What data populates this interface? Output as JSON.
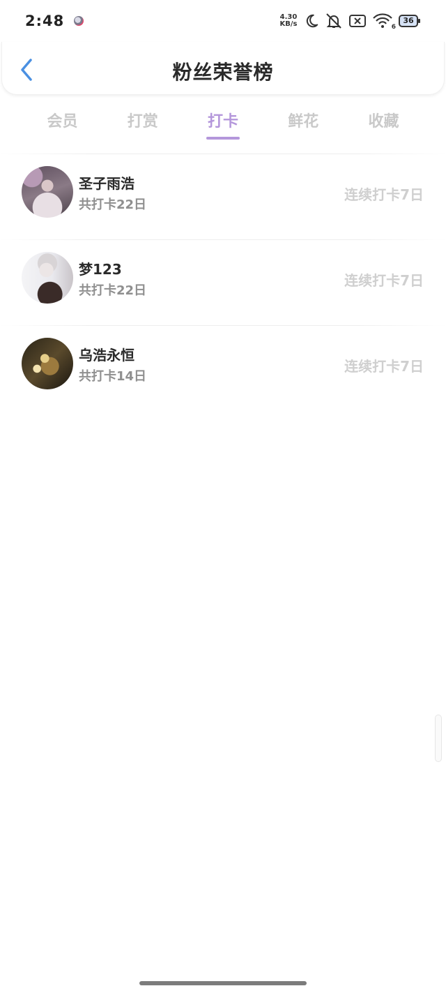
{
  "status_bar": {
    "time": "2:48",
    "net_speed_value": "4.30",
    "net_speed_unit": "KB/s",
    "wifi_label": "6",
    "battery_level": "36",
    "icons": [
      "notification-app-icon",
      "moon-icon",
      "mute-icon",
      "no-sim-icon",
      "wifi-icon",
      "battery-icon"
    ]
  },
  "header": {
    "title": "粉丝荣誉榜",
    "back_icon": "chevron-left-icon"
  },
  "tabs": [
    {
      "label": "会员",
      "active": false
    },
    {
      "label": "打赏",
      "active": false
    },
    {
      "label": "打卡",
      "active": true
    },
    {
      "label": "鲜花",
      "active": false
    },
    {
      "label": "收藏",
      "active": false
    }
  ],
  "list": [
    {
      "name": "圣子雨浩",
      "total": "共打卡22日",
      "streak": "连续打卡7日"
    },
    {
      "name": "梦123",
      "total": "共打卡22日",
      "streak": "连续打卡7日"
    },
    {
      "name": "乌浩永恒",
      "total": "共打卡14日",
      "streak": "连续打卡7日"
    }
  ],
  "colors": {
    "accent": "#b497db",
    "back_icon": "#4a90e2",
    "tab_inactive": "#c9c9c9",
    "streak_text": "#cfcfcf"
  }
}
